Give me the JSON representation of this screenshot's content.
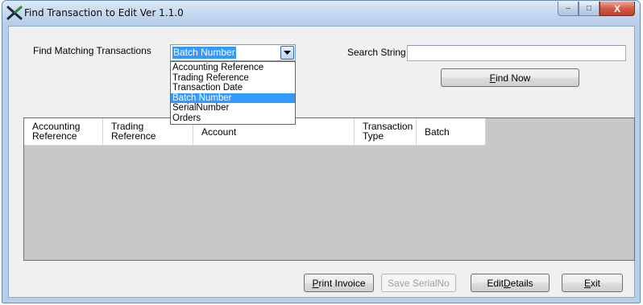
{
  "window": {
    "title": "Find Transaction to Edit Ver 1.1.0",
    "controls": {
      "minimize": "–",
      "maximize": "□",
      "close": "X"
    }
  },
  "form": {
    "find_label": "Find Matching Transactions",
    "selected_field": "Batch Number",
    "options": [
      "Accounting Reference",
      "Trading Reference",
      "Transaction Date",
      "Batch Number",
      "SerialNumber",
      "Orders"
    ],
    "search_label": "Search String",
    "search_value": "",
    "find_now": {
      "prefix": "",
      "mnemonic": "F",
      "rest": "ind Now"
    }
  },
  "grid": {
    "columns": [
      {
        "line1": "Accounting",
        "line2": "Reference"
      },
      {
        "line1": "Trading",
        "line2": "Reference"
      },
      {
        "line1": "Account",
        "line2": ""
      },
      {
        "line1": "Transaction",
        "line2": "Type"
      },
      {
        "line1": "Batch",
        "line2": ""
      }
    ]
  },
  "buttons": {
    "print_invoice": {
      "mnemonic": "P",
      "rest": "rint Invoice"
    },
    "save_serial": "Save SerialNo",
    "edit_details": {
      "prefix": "Edit ",
      "mnemonic": "D",
      "rest": "etails"
    },
    "exit": {
      "mnemonic": "E",
      "rest": "xit"
    }
  },
  "colors": {
    "selection": "#3399ff",
    "grid_bg": "#c8c8c8",
    "title_bar": "#c2d6ee"
  }
}
